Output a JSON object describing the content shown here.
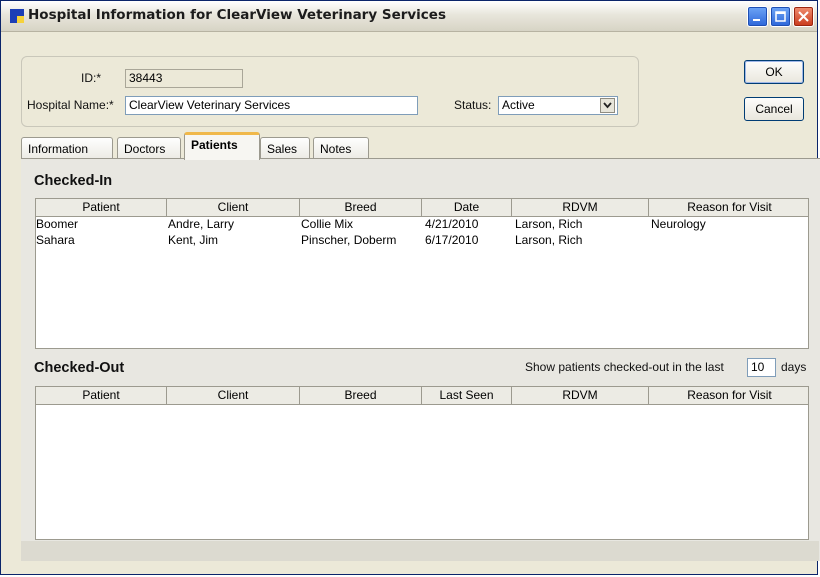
{
  "window": {
    "title": "Hospital Information for ClearView Veterinary Services",
    "controls": [
      "minimize-icon",
      "maximize-icon",
      "close-icon"
    ]
  },
  "header": {
    "id_label": "ID:*",
    "id_value": "38443",
    "name_label": "Hospital Name:*",
    "name_value": "ClearView Veterinary Services",
    "status_label": "Status:",
    "status_value": "Active"
  },
  "buttons": {
    "ok": "OK",
    "cancel": "Cancel"
  },
  "tabs": [
    {
      "label": "Information"
    },
    {
      "label": "Doctors"
    },
    {
      "label": "Patients",
      "active": true
    },
    {
      "label": "Sales"
    },
    {
      "label": "Notes"
    }
  ],
  "checked_in": {
    "title": "Checked-In",
    "columns": [
      "Patient",
      "Client",
      "Breed",
      "Date",
      "RDVM",
      "Reason for Visit"
    ],
    "rows": [
      [
        "Boomer",
        "Andre, Larry",
        "Collie Mix",
        "4/21/2010",
        "Larson, Rich",
        "Neurology"
      ],
      [
        "Sahara",
        "Kent, Jim",
        "Pinscher, Doberm",
        "6/17/2010",
        "Larson, Rich",
        ""
      ]
    ]
  },
  "checked_out": {
    "title": "Checked-Out",
    "filter_prefix": "Show patients checked-out in the last",
    "filter_value": "10",
    "filter_suffix": "days",
    "columns": [
      "Patient",
      "Client",
      "Breed",
      "Last Seen",
      "RDVM",
      "Reason for Visit"
    ],
    "rows": []
  },
  "colors": {
    "accent_tab": "#f0b84a",
    "title_buttons": "#2c66d9",
    "close_button": "#c9391a",
    "window_bg": "#ece9d8"
  }
}
